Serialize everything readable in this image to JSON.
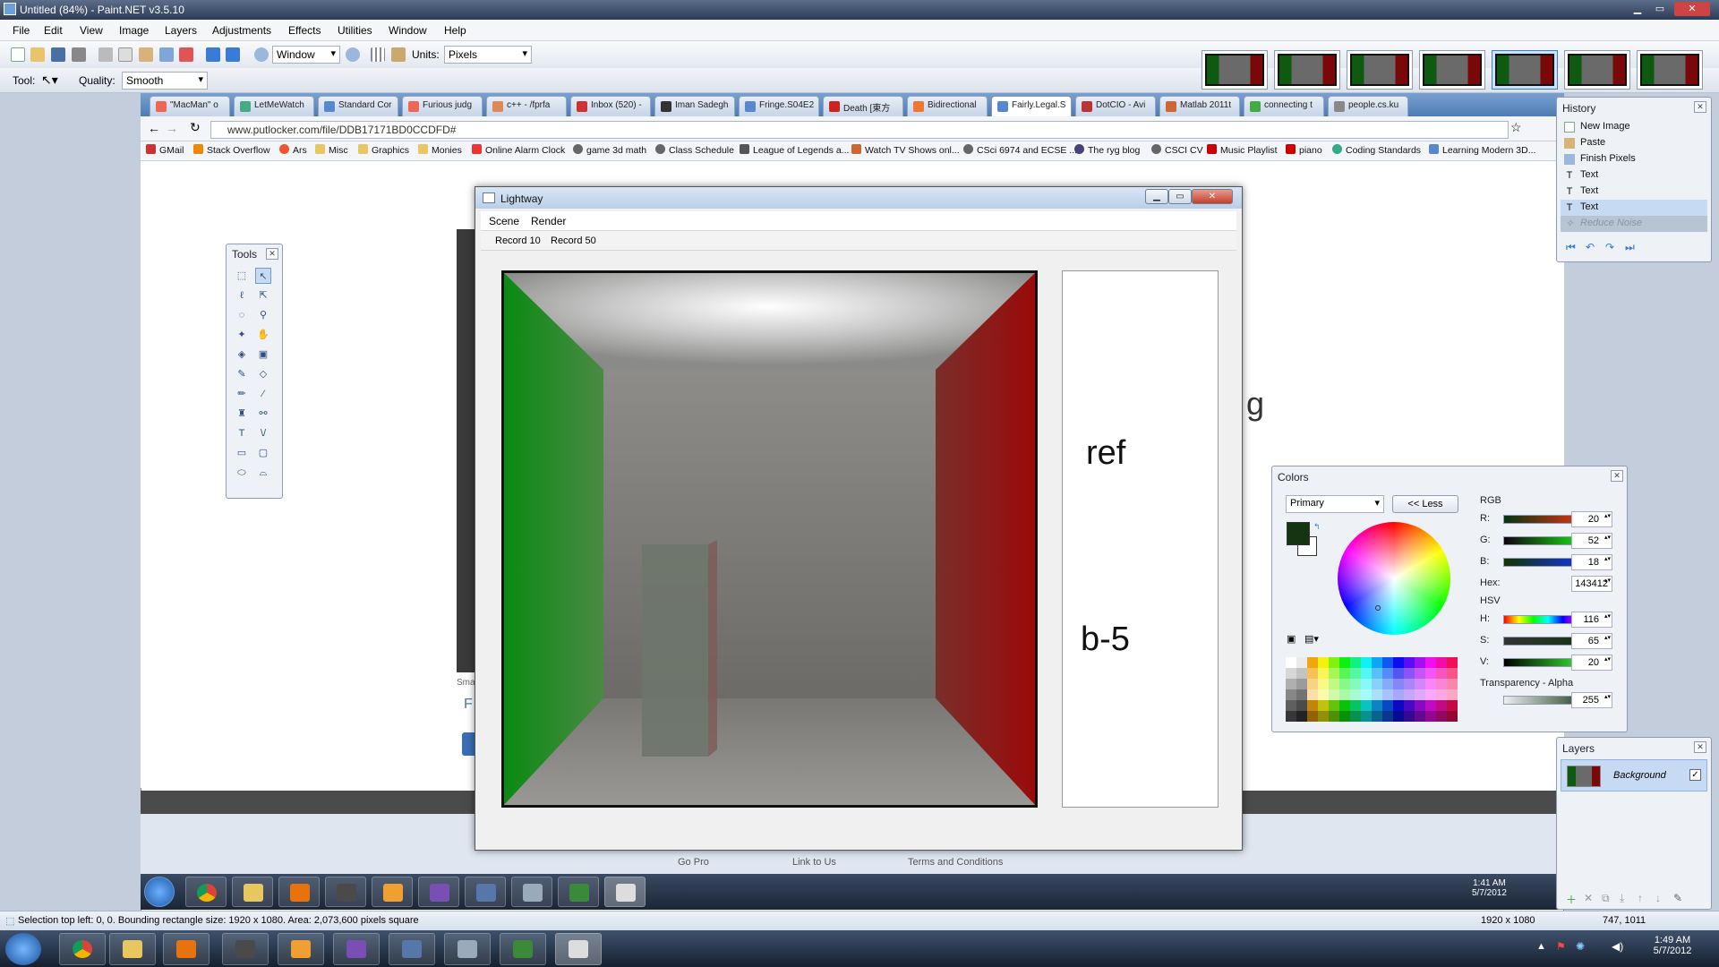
{
  "app": {
    "title": "Untitled (84%) - Paint.NET v3.5.10"
  },
  "menu": [
    "File",
    "Edit",
    "View",
    "Image",
    "Layers",
    "Adjustments",
    "Effects",
    "Utilities",
    "Window",
    "Help"
  ],
  "toolbar": {
    "zoom_mode": "Window",
    "units_label": "Units:",
    "units": "Pixels",
    "tool_label": "Tool:",
    "quality_label": "Quality:",
    "quality": "Smooth"
  },
  "browser": {
    "tabs": [
      "\"MacMan\" o",
      "LetMeWatch",
      "Standard Cor",
      "Furious judg",
      "c++ - /fprfa",
      "Inbox (520) -",
      "Iman Sadegh",
      "Fringe.S04E2",
      "Death [東方",
      "Bidirectional",
      "Fairly.Legal.S",
      "DotCIO - Avi",
      "Matlab 2011t",
      "connecting t",
      "people.cs.ku"
    ],
    "active_tab": 10,
    "url": "www.putlocker.com/file/DDB17171BD0CCDFD#",
    "bookmarks": [
      "GMail",
      "Stack Overflow",
      "Ars",
      "Misc",
      "Graphics",
      "Monies",
      "Online Alarm Clock",
      "game 3d math",
      "Class Schedule",
      "League of Legends a...",
      "Watch TV Shows onl...",
      "CSci 6974 and ECSE ...",
      "The ryg blog",
      "CSCI CV",
      "Music Playlist",
      "piano",
      "Coding Standards",
      "Learning Modern 3D..."
    ],
    "footer_links": [
      "Go Pro",
      "Link to Us",
      "Terms and Conditions"
    ],
    "page_fragments": {
      "right_letter": "g",
      "left_small": "Sma",
      "left_f": "F"
    }
  },
  "tools_window": {
    "title": "Tools"
  },
  "lightway": {
    "title": "Lightway",
    "menu": [
      "Scene",
      "Render"
    ],
    "buttons": [
      "Record 10",
      "Record 50"
    ],
    "labels": [
      "ref",
      "b-5"
    ]
  },
  "history": {
    "title": "History",
    "items": [
      "New Image",
      "Paste",
      "Finish Pixels",
      "Text",
      "Text",
      "Text",
      "Reduce Noise"
    ],
    "selected": 5
  },
  "colors": {
    "title": "Colors",
    "mode": "Primary",
    "less_button": "<< Less",
    "rgb_label": "RGB",
    "r": "20",
    "g": "52",
    "b": "18",
    "hex_label": "Hex:",
    "hex": "143412",
    "hsv_label": "HSV",
    "h": "116",
    "s": "65",
    "v": "20",
    "alpha_label": "Transparency - Alpha",
    "alpha": "255",
    "primary_color": "#143412"
  },
  "layers": {
    "title": "Layers",
    "items": [
      "Background"
    ]
  },
  "inner_clock": {
    "time": "1:41 AM",
    "date": "5/7/2012"
  },
  "status": {
    "text": "Selection top left: 0, 0. Bounding rectangle size: 1920 x 1080. Area: 2,073,600 pixels square",
    "size": "1920 x 1080",
    "pos": "747, 1011"
  },
  "clock": {
    "time": "1:49 AM",
    "date": "5/7/2012"
  }
}
